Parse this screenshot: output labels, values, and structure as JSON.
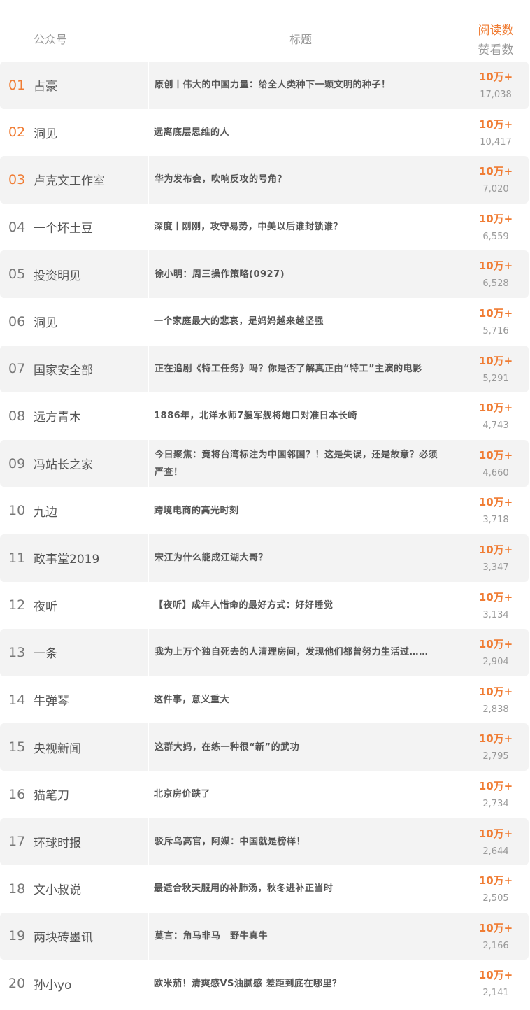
{
  "header": {
    "account_label": "公众号",
    "title_label": "标题",
    "reads_label": "阅读数",
    "likes_label": "赞看数"
  },
  "colors": {
    "accent": "#f07c33",
    "row_shade": "#f3f3f3",
    "muted": "#999999"
  },
  "rows": [
    {
      "rank": "01",
      "account": "占豪",
      "title": "原创丨伟大的中国力量：给全人类种下一颗文明的种子！",
      "reads": "10万+",
      "likes": "17,038"
    },
    {
      "rank": "02",
      "account": "洞见",
      "title": "远离底层思维的人",
      "reads": "10万+",
      "likes": "10,417"
    },
    {
      "rank": "03",
      "account": "卢克文工作室",
      "title": "华为发布会，吹响反攻的号角？",
      "reads": "10万+",
      "likes": "7,020"
    },
    {
      "rank": "04",
      "account": "一个坏土豆",
      "title": "深度丨刚刚，攻守易势，中美以后谁封锁谁？",
      "reads": "10万+",
      "likes": "6,559"
    },
    {
      "rank": "05",
      "account": "投资明见",
      "title": "徐小明：周三操作策略(0927)",
      "reads": "10万+",
      "likes": "6,528"
    },
    {
      "rank": "06",
      "account": "洞见",
      "title": "一个家庭最大的悲哀，是妈妈越来越坚强",
      "reads": "10万+",
      "likes": "5,716"
    },
    {
      "rank": "07",
      "account": "国家安全部",
      "title": "正在追剧《特工任务》吗？你是否了解真正由“特工”主演的电影",
      "reads": "10万+",
      "likes": "5,291"
    },
    {
      "rank": "08",
      "account": "远方青木",
      "title": "1886年，北洋水师7艘军舰将炮口对准日本长崎",
      "reads": "10万+",
      "likes": "4,743"
    },
    {
      "rank": "09",
      "account": "冯站长之家",
      "title": "今日聚焦：竟将台湾标注为中国邻国？！这是失误，还是故意？必须严查！",
      "reads": "10万+",
      "likes": "4,660"
    },
    {
      "rank": "10",
      "account": "九边",
      "title": "跨境电商的高光时刻",
      "reads": "10万+",
      "likes": "3,718"
    },
    {
      "rank": "11",
      "account": "政事堂2019",
      "title": "宋江为什么能成江湖大哥？",
      "reads": "10万+",
      "likes": "3,347"
    },
    {
      "rank": "12",
      "account": "夜听",
      "title": "【夜听】成年人惜命的最好方式：好好睡觉",
      "reads": "10万+",
      "likes": "3,134"
    },
    {
      "rank": "13",
      "account": "一条",
      "title": "我为上万个独自死去的人清理房间，发现他们都曾努力生活过……",
      "reads": "10万+",
      "likes": "2,904"
    },
    {
      "rank": "14",
      "account": "牛弹琴",
      "title": "这件事，意义重大",
      "reads": "10万+",
      "likes": "2,838"
    },
    {
      "rank": "15",
      "account": "央视新闻",
      "title": "这群大妈，在练一种很“新”的武功",
      "reads": "10万+",
      "likes": "2,795"
    },
    {
      "rank": "16",
      "account": "猫笔刀",
      "title": "北京房价跌了",
      "reads": "10万+",
      "likes": "2,734"
    },
    {
      "rank": "17",
      "account": "环球时报",
      "title": "驳斥乌高官，阿媒：中国就是榜样！",
      "reads": "10万+",
      "likes": "2,644"
    },
    {
      "rank": "18",
      "account": "文小叔说",
      "title": "最适合秋天服用的补肺汤，秋冬进补正当时",
      "reads": "10万+",
      "likes": "2,505"
    },
    {
      "rank": "19",
      "account": "两块砖墨讯",
      "title": "莫言：角马非马　野牛真牛",
      "reads": "10万+",
      "likes": "2,166"
    },
    {
      "rank": "20",
      "account": "孙小yo",
      "title": "欧米茄！清爽感VS油腻感 差距到底在哪里？",
      "reads": "10万+",
      "likes": "2,141"
    }
  ]
}
